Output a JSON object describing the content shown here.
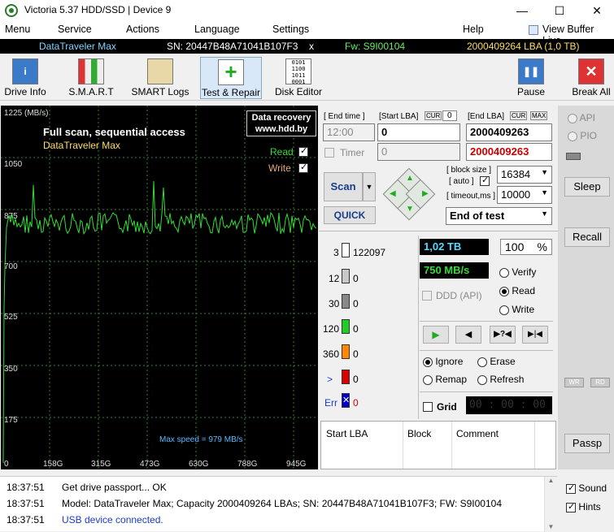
{
  "window": {
    "title": "Victoria 5.37 HDD/SSD | Device 9",
    "min": "—",
    "max": "☐",
    "close": "✕"
  },
  "menu": [
    "Menu",
    "Service",
    "Actions",
    "Language",
    "Settings",
    "Help"
  ],
  "view_buffer": "View Buffer Live",
  "infobar": {
    "device": "DataTraveler Max",
    "sn": "SN: 20447B48A71041B107F3",
    "x": "x",
    "fw": "Fw: S9I00104",
    "lba": "2000409264 LBA (1,0 TB)"
  },
  "toolbar": [
    "Drive Info",
    "S.M.A.R.T",
    "SMART Logs",
    "Test & Repair",
    "Disk Editor",
    "Pause",
    "Break All"
  ],
  "graph": {
    "y_unit": "1225 (MB/s)",
    "y_ticks": [
      "1050",
      "875",
      "700",
      "525",
      "350",
      "175",
      "0"
    ],
    "x_ticks": [
      "158G",
      "315G",
      "473G",
      "630G",
      "788G",
      "945G"
    ],
    "title": "Full scan, sequential access",
    "device": "DataTraveler Max",
    "read_label": "Read",
    "write_label": "Write",
    "recovery1": "Data recovery",
    "recovery2": "www.hdd.by",
    "max_speed": "Max speed = 979 MB/s",
    "colors": {
      "read": "#33dd33",
      "write": "#ffcc66",
      "grid": "#3a7a3a"
    }
  },
  "test": {
    "end_time_label": "[ End time ]",
    "start_lba_label": "[Start LBA]",
    "cur": "CUR",
    "zero": "0",
    "end_lba_label": "[End LBA]",
    "max": "MAX",
    "time": "12:00",
    "start_lba": "0",
    "end_lba": "2000409263",
    "timer_label": "Timer",
    "timer_value": "0",
    "end_lba2": "2000409263",
    "block_size_label": "[ block size ]",
    "auto_label": "[ auto ]",
    "block_size": "16384",
    "timeout_label": "[ timeout,ms ]",
    "timeout": "10000",
    "scan": "Scan",
    "quick": "QUICK",
    "end_of_test": "End of test"
  },
  "counts": [
    {
      "label": "3",
      "value": "122097",
      "color": "#ffffff"
    },
    {
      "label": "12",
      "value": "0",
      "color": "#c8c8c8"
    },
    {
      "label": "30",
      "value": "0",
      "color": "#888888"
    },
    {
      "label": "120",
      "value": "0",
      "color": "#22cc22"
    },
    {
      "label": "360",
      "value": "0",
      "color": "#ff8800"
    },
    {
      "label": ">",
      "value": "0",
      "color": "#dd0000"
    },
    {
      "label": "Err",
      "value": "0",
      "color": "#0000cc"
    }
  ],
  "status": {
    "size": "1,02 TB",
    "percent": "100",
    "pct_sign": "%",
    "speed": "750 MB/s",
    "ddd": "DDD (API)"
  },
  "modes": {
    "verify": "Verify",
    "read": "Read",
    "write": "Write"
  },
  "actions": {
    "ignore": "Ignore",
    "erase": "Erase",
    "remap": "Remap",
    "refresh": "Refresh"
  },
  "grid_label": "Grid",
  "grid_time": "00 : 00 : 00",
  "table": {
    "col1": "Start LBA",
    "col2": "Block",
    "col3": "Comment"
  },
  "right": {
    "api": "API",
    "pio": "PIO",
    "sleep": "Sleep",
    "recall": "Recall",
    "wr": "WR",
    "rd": "RD",
    "passp": "Passp"
  },
  "log": [
    {
      "time": "18:37:51",
      "text": "Get drive passport... OK",
      "color": "#000000"
    },
    {
      "time": "18:37:51",
      "text": "Model: DataTraveler Max; Capacity 2000409264 LBAs; SN: 20447B48A71041B107F3; FW: S9I00104",
      "color": "#000000"
    },
    {
      "time": "18:37:51",
      "text": "USB device connected.",
      "color": "#1a3cc8"
    }
  ],
  "bottom_right": {
    "sound": "Sound",
    "hints": "Hints"
  }
}
